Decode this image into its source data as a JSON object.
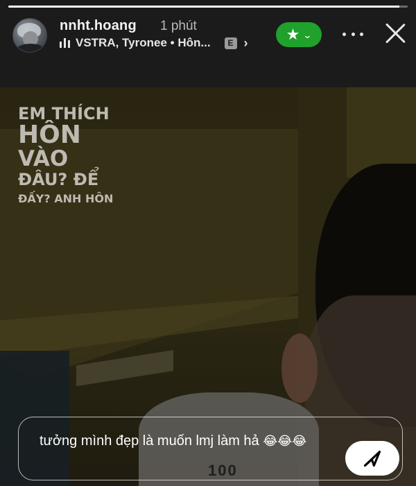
{
  "story": {
    "progress": 0.98,
    "username": "nnht.hoang",
    "time_ago": "1 phút",
    "music_label": "VSTRA, Tyronee • Hôn...",
    "explicit_badge": "E",
    "overlay_lines": [
      "EM THÍCH",
      "HÔN",
      "VÀO",
      "ĐÂU? ĐỂ",
      "ĐẤY? ANH HÔN"
    ],
    "shirt_print": "100"
  },
  "header": {
    "favorite_icon": "star-icon",
    "more_icon": "more-horizontal-icon",
    "close_icon": "close-icon"
  },
  "reply": {
    "text": "tưởng mình đẹp là muốn lmj làm hả",
    "emojis": "😂😂😂",
    "send_icon": "send-icon"
  },
  "colors": {
    "favorite_pill": "#1fa12b",
    "header_bg": "#1b1b1c"
  }
}
